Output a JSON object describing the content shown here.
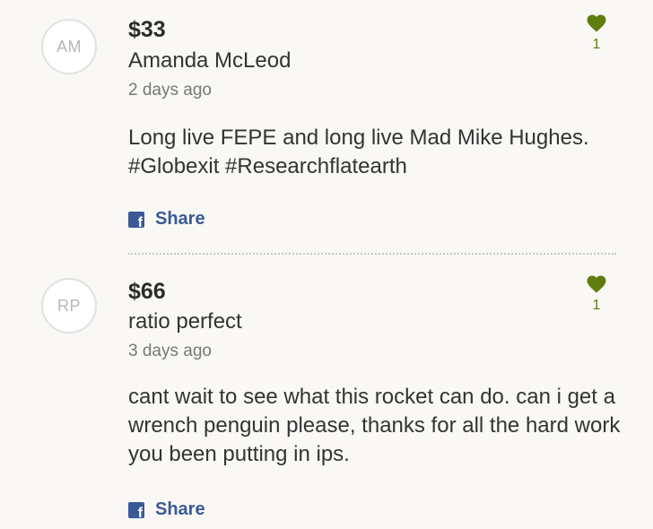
{
  "donations": [
    {
      "initials": "AM",
      "amount": "$33",
      "name": "Amanda McLeod",
      "timestamp": "2 days ago",
      "comment": "Long live FEPE and long live Mad Mike Hughes. #Globexit #Researchflatearth",
      "share_label": "Share",
      "likes": "1"
    },
    {
      "initials": "RP",
      "amount": "$66",
      "name": "ratio perfect",
      "timestamp": "3 days ago",
      "comment": "cant wait to see what this rocket can do. can i get a wrench penguin please, thanks for all the hard work you been putting in ips.",
      "share_label": "Share",
      "likes": "1"
    }
  ],
  "icons": {
    "share": "facebook-icon",
    "like": "heart-icon"
  },
  "colors": {
    "background": "#f9f8f4",
    "share": "#3b5998",
    "heart": "#5e7d0e",
    "avatar_border": "#e1e1e1",
    "divider": "#c8c8c8"
  }
}
